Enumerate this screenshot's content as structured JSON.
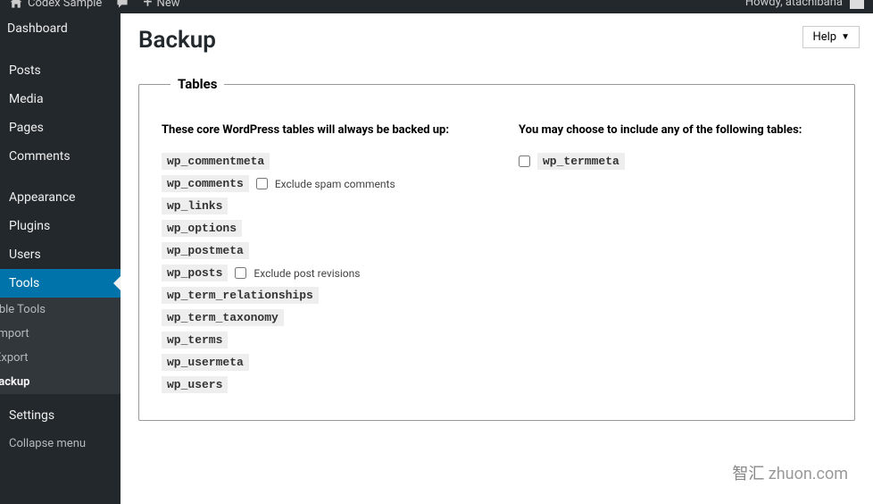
{
  "topbar": {
    "site_name": "Codex Sample",
    "comment_count": "",
    "new_label": "New",
    "howdy": "Howdy, atachibana"
  },
  "sidebar": {
    "dashboard": "Dashboard",
    "posts": "Posts",
    "media": "Media",
    "pages": "Pages",
    "comments": "Comments",
    "appearance": "Appearance",
    "plugins": "Plugins",
    "users": "Users",
    "tools": "Tools",
    "tools_sub": {
      "available": "Available Tools",
      "import": "Import",
      "export": "Export",
      "backup": "Backup"
    },
    "settings": "Settings",
    "collapse": "Collapse menu"
  },
  "page": {
    "help": "Help",
    "title": "Backup",
    "fieldset_legend": "Tables",
    "core_heading": "These core WordPress tables will always be backed up:",
    "optional_heading": "You may choose to include any of the following tables:",
    "core_tables": {
      "t0": "wp_commentmeta",
      "t1": "wp_comments",
      "t1_opt": "Exclude spam comments",
      "t2": "wp_links",
      "t3": "wp_options",
      "t4": "wp_postmeta",
      "t5": "wp_posts",
      "t5_opt": "Exclude post revisions",
      "t6": "wp_term_relationships",
      "t7": "wp_term_taxonomy",
      "t8": "wp_terms",
      "t9": "wp_usermeta",
      "t10": "wp_users"
    },
    "optional_tables": {
      "t0": "wp_termmeta"
    }
  },
  "watermark": {
    "zh": "智汇",
    "en": "zhuon.com"
  }
}
